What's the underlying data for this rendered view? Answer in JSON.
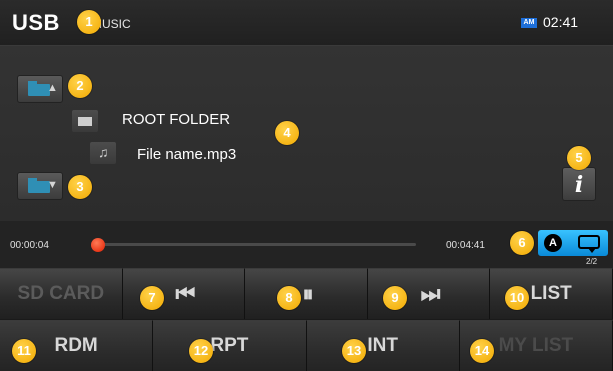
{
  "header": {
    "source": "USB",
    "mode": "MUSIC",
    "band_badge": "AM",
    "clock": "02:41"
  },
  "browser": {
    "folder_up_icon": "folder-up-icon",
    "folder_down_icon": "folder-down-icon",
    "root_folder_label": "ROOT FOLDER",
    "file_label": "File name.mp3",
    "info_label": "i"
  },
  "progress": {
    "elapsed": "00:00:04",
    "total": "00:04:41",
    "position_fraction": 0.014,
    "repeat_mode_label": "A",
    "track_count": "2/2",
    "accent_color": "#e11c00",
    "mode_color": "#1aa6ee"
  },
  "controls_row1": [
    {
      "label": "SD CARD",
      "enabled": false
    },
    {
      "label": "⏮",
      "icon": "previous-track-icon",
      "enabled": true
    },
    {
      "label": "⏸",
      "icon": "pause-icon",
      "enabled": true
    },
    {
      "label": "⏭",
      "icon": "next-track-icon",
      "enabled": true
    },
    {
      "label": "LIST",
      "enabled": true
    }
  ],
  "controls_row2": [
    {
      "label": "RDM",
      "enabled": true
    },
    {
      "label": "RPT",
      "enabled": true
    },
    {
      "label": "INT",
      "enabled": true
    },
    {
      "label": "MY LIST",
      "enabled": false
    }
  ],
  "badges": [
    "1",
    "2",
    "3",
    "4",
    "5",
    "6",
    "7",
    "8",
    "9",
    "10",
    "11",
    "12",
    "13",
    "14"
  ],
  "badge_color": "#f5b400"
}
